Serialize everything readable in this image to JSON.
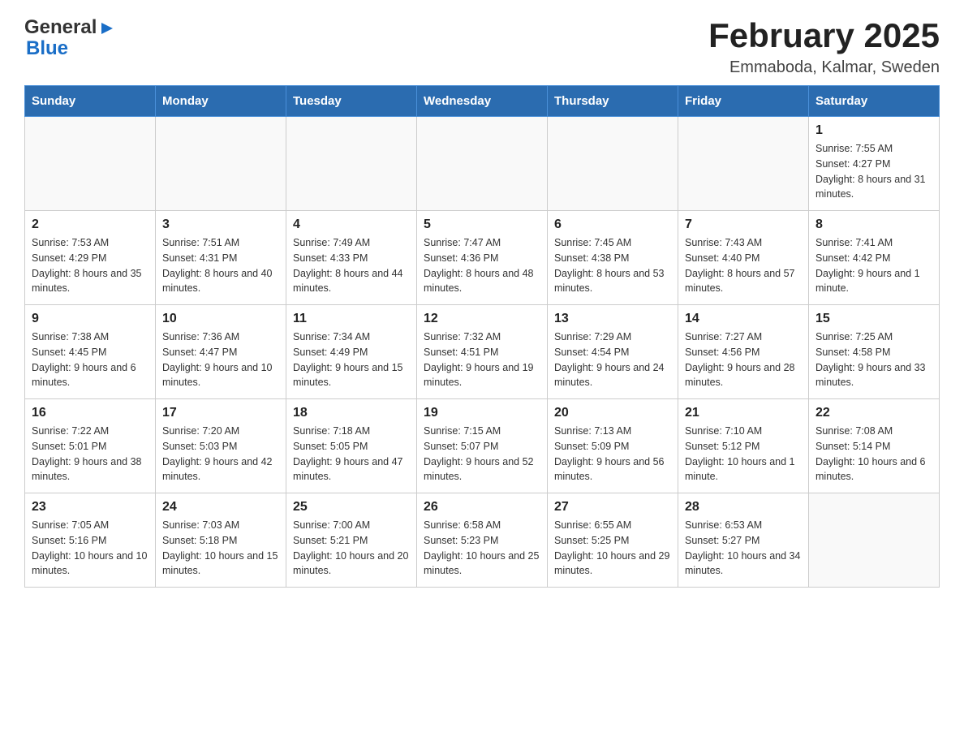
{
  "logo": {
    "general": "General",
    "blue": "Blue",
    "arrow_symbol": "▶"
  },
  "header": {
    "month_year": "February 2025",
    "location": "Emmaboda, Kalmar, Sweden"
  },
  "days_of_week": [
    "Sunday",
    "Monday",
    "Tuesday",
    "Wednesday",
    "Thursday",
    "Friday",
    "Saturday"
  ],
  "weeks": [
    {
      "days": [
        {
          "number": "",
          "sunrise": "",
          "sunset": "",
          "daylight": ""
        },
        {
          "number": "",
          "sunrise": "",
          "sunset": "",
          "daylight": ""
        },
        {
          "number": "",
          "sunrise": "",
          "sunset": "",
          "daylight": ""
        },
        {
          "number": "",
          "sunrise": "",
          "sunset": "",
          "daylight": ""
        },
        {
          "number": "",
          "sunrise": "",
          "sunset": "",
          "daylight": ""
        },
        {
          "number": "",
          "sunrise": "",
          "sunset": "",
          "daylight": ""
        },
        {
          "number": "1",
          "sunrise": "Sunrise: 7:55 AM",
          "sunset": "Sunset: 4:27 PM",
          "daylight": "Daylight: 8 hours and 31 minutes."
        }
      ]
    },
    {
      "days": [
        {
          "number": "2",
          "sunrise": "Sunrise: 7:53 AM",
          "sunset": "Sunset: 4:29 PM",
          "daylight": "Daylight: 8 hours and 35 minutes."
        },
        {
          "number": "3",
          "sunrise": "Sunrise: 7:51 AM",
          "sunset": "Sunset: 4:31 PM",
          "daylight": "Daylight: 8 hours and 40 minutes."
        },
        {
          "number": "4",
          "sunrise": "Sunrise: 7:49 AM",
          "sunset": "Sunset: 4:33 PM",
          "daylight": "Daylight: 8 hours and 44 minutes."
        },
        {
          "number": "5",
          "sunrise": "Sunrise: 7:47 AM",
          "sunset": "Sunset: 4:36 PM",
          "daylight": "Daylight: 8 hours and 48 minutes."
        },
        {
          "number": "6",
          "sunrise": "Sunrise: 7:45 AM",
          "sunset": "Sunset: 4:38 PM",
          "daylight": "Daylight: 8 hours and 53 minutes."
        },
        {
          "number": "7",
          "sunrise": "Sunrise: 7:43 AM",
          "sunset": "Sunset: 4:40 PM",
          "daylight": "Daylight: 8 hours and 57 minutes."
        },
        {
          "number": "8",
          "sunrise": "Sunrise: 7:41 AM",
          "sunset": "Sunset: 4:42 PM",
          "daylight": "Daylight: 9 hours and 1 minute."
        }
      ]
    },
    {
      "days": [
        {
          "number": "9",
          "sunrise": "Sunrise: 7:38 AM",
          "sunset": "Sunset: 4:45 PM",
          "daylight": "Daylight: 9 hours and 6 minutes."
        },
        {
          "number": "10",
          "sunrise": "Sunrise: 7:36 AM",
          "sunset": "Sunset: 4:47 PM",
          "daylight": "Daylight: 9 hours and 10 minutes."
        },
        {
          "number": "11",
          "sunrise": "Sunrise: 7:34 AM",
          "sunset": "Sunset: 4:49 PM",
          "daylight": "Daylight: 9 hours and 15 minutes."
        },
        {
          "number": "12",
          "sunrise": "Sunrise: 7:32 AM",
          "sunset": "Sunset: 4:51 PM",
          "daylight": "Daylight: 9 hours and 19 minutes."
        },
        {
          "number": "13",
          "sunrise": "Sunrise: 7:29 AM",
          "sunset": "Sunset: 4:54 PM",
          "daylight": "Daylight: 9 hours and 24 minutes."
        },
        {
          "number": "14",
          "sunrise": "Sunrise: 7:27 AM",
          "sunset": "Sunset: 4:56 PM",
          "daylight": "Daylight: 9 hours and 28 minutes."
        },
        {
          "number": "15",
          "sunrise": "Sunrise: 7:25 AM",
          "sunset": "Sunset: 4:58 PM",
          "daylight": "Daylight: 9 hours and 33 minutes."
        }
      ]
    },
    {
      "days": [
        {
          "number": "16",
          "sunrise": "Sunrise: 7:22 AM",
          "sunset": "Sunset: 5:01 PM",
          "daylight": "Daylight: 9 hours and 38 minutes."
        },
        {
          "number": "17",
          "sunrise": "Sunrise: 7:20 AM",
          "sunset": "Sunset: 5:03 PM",
          "daylight": "Daylight: 9 hours and 42 minutes."
        },
        {
          "number": "18",
          "sunrise": "Sunrise: 7:18 AM",
          "sunset": "Sunset: 5:05 PM",
          "daylight": "Daylight: 9 hours and 47 minutes."
        },
        {
          "number": "19",
          "sunrise": "Sunrise: 7:15 AM",
          "sunset": "Sunset: 5:07 PM",
          "daylight": "Daylight: 9 hours and 52 minutes."
        },
        {
          "number": "20",
          "sunrise": "Sunrise: 7:13 AM",
          "sunset": "Sunset: 5:09 PM",
          "daylight": "Daylight: 9 hours and 56 minutes."
        },
        {
          "number": "21",
          "sunrise": "Sunrise: 7:10 AM",
          "sunset": "Sunset: 5:12 PM",
          "daylight": "Daylight: 10 hours and 1 minute."
        },
        {
          "number": "22",
          "sunrise": "Sunrise: 7:08 AM",
          "sunset": "Sunset: 5:14 PM",
          "daylight": "Daylight: 10 hours and 6 minutes."
        }
      ]
    },
    {
      "days": [
        {
          "number": "23",
          "sunrise": "Sunrise: 7:05 AM",
          "sunset": "Sunset: 5:16 PM",
          "daylight": "Daylight: 10 hours and 10 minutes."
        },
        {
          "number": "24",
          "sunrise": "Sunrise: 7:03 AM",
          "sunset": "Sunset: 5:18 PM",
          "daylight": "Daylight: 10 hours and 15 minutes."
        },
        {
          "number": "25",
          "sunrise": "Sunrise: 7:00 AM",
          "sunset": "Sunset: 5:21 PM",
          "daylight": "Daylight: 10 hours and 20 minutes."
        },
        {
          "number": "26",
          "sunrise": "Sunrise: 6:58 AM",
          "sunset": "Sunset: 5:23 PM",
          "daylight": "Daylight: 10 hours and 25 minutes."
        },
        {
          "number": "27",
          "sunrise": "Sunrise: 6:55 AM",
          "sunset": "Sunset: 5:25 PM",
          "daylight": "Daylight: 10 hours and 29 minutes."
        },
        {
          "number": "28",
          "sunrise": "Sunrise: 6:53 AM",
          "sunset": "Sunset: 5:27 PM",
          "daylight": "Daylight: 10 hours and 34 minutes."
        },
        {
          "number": "",
          "sunrise": "",
          "sunset": "",
          "daylight": ""
        }
      ]
    }
  ]
}
